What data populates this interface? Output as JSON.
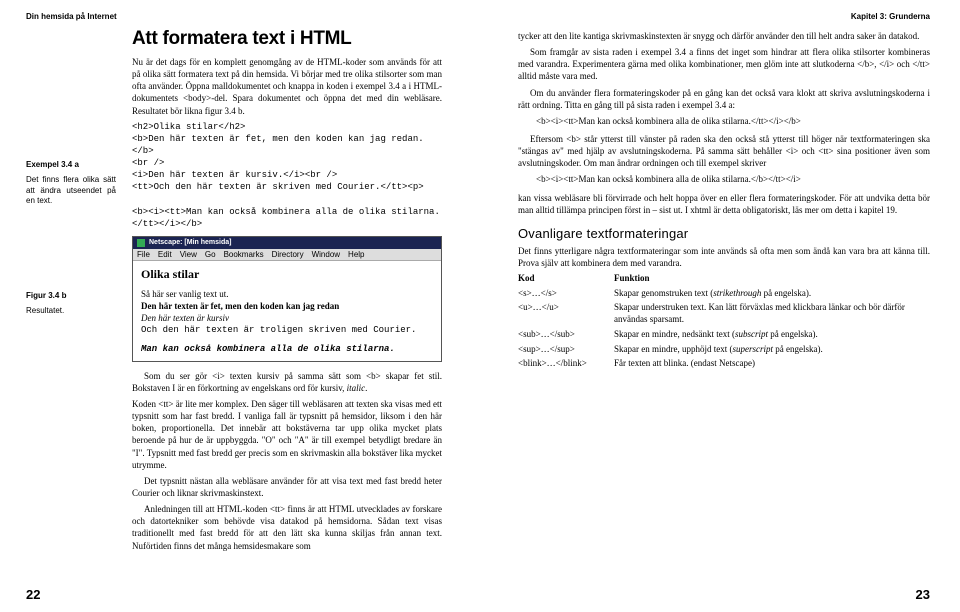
{
  "left": {
    "runhead": "Din hemsida på Internet",
    "pgnum": "22",
    "margin1_title": "Exempel 3.4 a",
    "margin1_body": "Det finns flera olika sätt att ändra utseendet på en text.",
    "margin2_title": "Figur 3.4 b",
    "margin2_body": "Resultatet.",
    "h1": "Att formatera text i HTML",
    "p1": "Nu är det dags för en komplett genomgång av de HTML-koder som används för att på olika sätt formatera text på din hemsida. Vi börjar med tre olika stilsorter som man ofta använder. Öppna malldokumentet och knappa in koden i exempel 3.4 a i HTML-dokumentets <body>-del. Spara dokumentet och öppna det med din webläsare. Resultatet bör likna figur 3.4 b.",
    "code": "<h2>Olika stilar</h2>\n<b>Den här texten är fet, men den koden kan jag redan.</b>\n<br />\n<i>Den här texten är kursiv.</i><br />\n<tt>Och den här texten är skriven med Courier.</tt><p>\n\n<b><i><tt>Man kan också kombinera alla de olika stilarna.</tt></i></b>",
    "browser": {
      "title": "Netscape: [Min hemsida]",
      "menu": [
        "File",
        "Edit",
        "View",
        "Go",
        "Bookmarks",
        "Directory",
        "Window",
        "Help"
      ],
      "h3": "Olika stilar",
      "l1": "Så här ser vanlig text ut.",
      "l2": "Den här texten är fet, men den koden kan jag redan",
      "l3": "Den här texten är kursiv",
      "l4": "Och den här texten är troligen skriven med Courier.",
      "l5": "Man kan också kombinera alla de olika stilarna."
    },
    "p2": "Som du ser gör <i> texten kursiv på samma sätt som <b> skapar fet stil. Bokstaven I är en förkortning av engelskans ord för kursiv, ",
    "p2i": "italic",
    "p2b": ".",
    "p3a": "Koden <tt> är lite mer komplex. Den säger till webläsaren att texten ska visas med ett typsnitt som har fast bredd. I vanliga fall är typsnitt på hemsidor, liksom i den här boken, proportionella. Det innebär att bokstäverna tar upp olika mycket plats beroende på hur de är uppbyggda. \"O\" och \"A\" är till exempel betydligt bredare än \"I\". Typsnitt med fast bredd ger precis som en skrivmaskin alla bokstäver lika mycket utrymme.",
    "p4": "Det typsnitt nästan alla webläsare använder för att visa text med fast bredd heter Courier och liknar skrivmaskinstext.",
    "p5": "Anledningen till att HTML-koden <tt> finns är att HTML utvecklades av forskare och datortekniker som behövde visa datakod på hemsidorna. Sådan text visas traditionellt med fast bredd för att den lätt ska kunna skiljas från annan text. Nuförtiden finns det många hemsidesmakare som"
  },
  "right": {
    "runhead": "Kapitel 3: Grunderna",
    "pgnum": "23",
    "p1": "tycker att den lite kantiga skrivmaskinstexten är snygg och därför använder den till helt andra saker än datakod.",
    "p2": "Som framgår av sista raden i exempel 3.4 a finns det inget som hindrar att flera olika stilsorter kombineras med varandra. Experimentera gärna med olika kombinationer, men glöm inte att slutkoderna </b>, </i> och </tt> alltid måste vara med.",
    "p3": "Om du använder flera formateringskoder på en gång kan det också vara klokt att skriva avslutningskoderna i rätt ordning. Titta en gång till på sista raden i exempel 3.4 a:",
    "q1": "<b><i><tt>Man kan också kombinera alla de olika stilarna.</tt></i></b>",
    "p4": "Eftersom <b> står ytterst till vänster på raden ska den också stå ytterst till höger när textformateringen ska \"stängas av\" med hjälp av avslutningskoderna. På samma sätt behåller <i> och <tt> sina positioner även som avslutningskoder. Om man ändrar ordningen och till exempel skriver",
    "q2": "<b><i><tt>Man kan också kombinera alla de olika stilarna.</b></tt></i>",
    "p5": "kan vissa webläsare bli förvirrade och helt hoppa över en eller flera formateringskoder. För att undvika detta bör man alltid tillämpa principen först in – sist ut. I xhtml är detta obligatoriskt, läs mer om detta i kapitel 19.",
    "h2": "Ovanligare textformateringar",
    "p6": "Det finns ytterligare några textformateringar som inte används så ofta men som ändå kan vara bra att känna till. Prova själv att kombinera dem med varandra.",
    "th1": "Kod",
    "th2": "Funktion",
    "r1a": "<s>…</s>",
    "r1b": "Skapar genomstruken text (",
    "r1bi": "strikethrough",
    "r1bc": " på engelska).",
    "r2a": "<u>…</u>",
    "r2b": "Skapar understruken text. Kan lätt förväxlas med klickbara länkar och bör därför användas sparsamt.",
    "r3a": "<sub>…</sub>",
    "r3b": "Skapar en mindre, nedsänkt text (",
    "r3bi": "subscript",
    "r3bc": " på engelska).",
    "r4a": "<sup>…</sup>",
    "r4b": "Skapar en mindre, upphöjd text (",
    "r4bi": "superscript",
    "r4bc": " på engelska).",
    "r5a": "<blink>…</blink>",
    "r5b": "Får texten att blinka. (endast Netscape)"
  }
}
